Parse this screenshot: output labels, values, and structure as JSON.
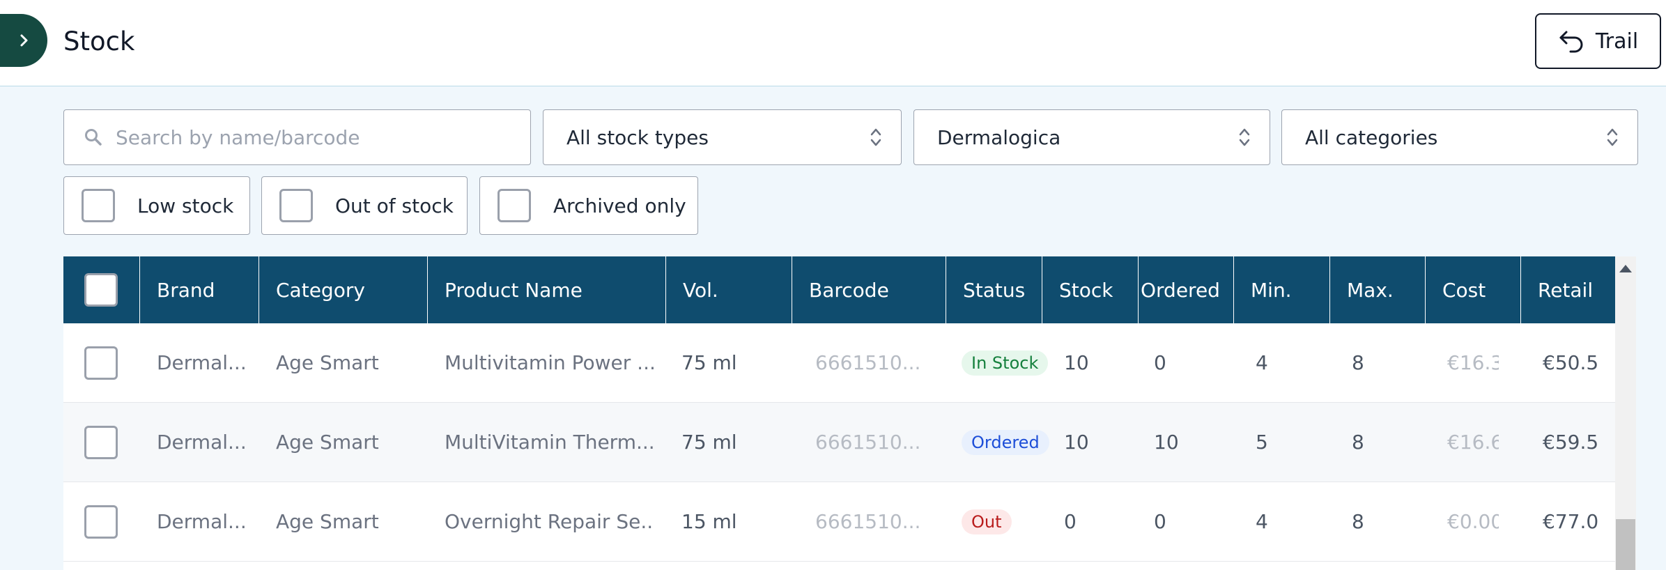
{
  "header": {
    "title": "Stock",
    "trail_label": "Trail"
  },
  "filters": {
    "search_placeholder": "Search by name/barcode",
    "stock_type": "All stock types",
    "brand": "Dermalogica",
    "category": "All categories",
    "checkbox_low": "Low stock",
    "checkbox_out": "Out of stock",
    "checkbox_archived": "Archived only"
  },
  "table": {
    "columns": [
      "Brand",
      "Category",
      "Product Name",
      "Vol.",
      "Barcode",
      "Status",
      "Stock",
      "Ordered",
      "Min.",
      "Max.",
      "Cost",
      "Retail"
    ],
    "rows": [
      {
        "brand": "Dermal...",
        "category": "Age Smart",
        "product": "Multivitamin Power ...",
        "vol": "75 ml",
        "barcode": "6661510...",
        "status": "In Stock",
        "stock": "10",
        "ordered": "0",
        "min": "4",
        "max": "8",
        "cost": "€16.3(",
        "retail": "€50.5"
      },
      {
        "brand": "Dermal...",
        "category": "Age Smart",
        "product": "MultiVitamin Therm...",
        "vol": "75 ml",
        "barcode": "6661510...",
        "status": "Ordered",
        "stock": "10",
        "ordered": "10",
        "min": "5",
        "max": "8",
        "cost": "€16.6(",
        "retail": "€59.5"
      },
      {
        "brand": "Dermal...",
        "category": "Age Smart",
        "product": "Overnight Repair Se...",
        "vol": "15 ml",
        "barcode": "6661510...",
        "status": "Out",
        "stock": "0",
        "ordered": "0",
        "min": "4",
        "max": "8",
        "cost": "€0.00",
        "retail": "€77.0("
      }
    ]
  },
  "colors": {
    "header_bg": "#0f4c6e",
    "toggle_bg": "#154a41",
    "in_stock_bg": "#e6f7ec",
    "in_stock_fg": "#15803d",
    "ordered_bg": "#e8f0fd",
    "ordered_fg": "#1d4ed8",
    "out_bg": "#fde8e8",
    "out_fg": "#b91c1c"
  },
  "icons": {
    "toggle": "chevron-right-icon",
    "trail": "undo-arrow-icon",
    "search": "search-icon",
    "select": "up-down-chevron-icon"
  }
}
